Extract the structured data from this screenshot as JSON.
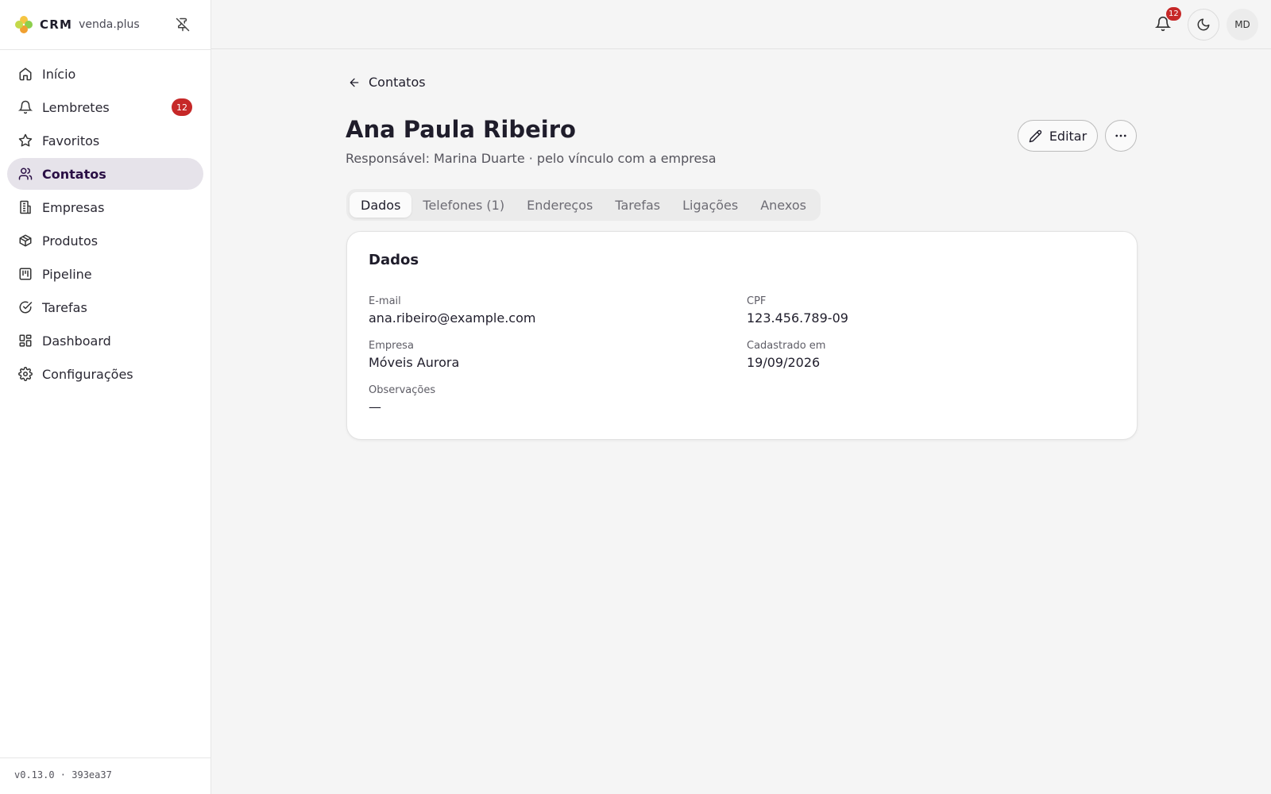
{
  "brand": {
    "name": "CRM",
    "subtitle": "venda.plus"
  },
  "sidebar": {
    "items": [
      {
        "label": "Início",
        "icon": "home-icon"
      },
      {
        "label": "Lembretes",
        "icon": "bell-icon",
        "badge": "12"
      },
      {
        "label": "Favoritos",
        "icon": "star-icon"
      },
      {
        "label": "Contatos",
        "icon": "users-icon",
        "active": true
      },
      {
        "label": "Empresas",
        "icon": "building-icon"
      },
      {
        "label": "Produtos",
        "icon": "package-icon"
      },
      {
        "label": "Pipeline",
        "icon": "kanban-icon"
      },
      {
        "label": "Tarefas",
        "icon": "check-circle-icon"
      },
      {
        "label": "Dashboard",
        "icon": "dashboard-icon"
      },
      {
        "label": "Configurações",
        "icon": "gear-icon"
      }
    ],
    "version": "v0.13.0 · 393ea37"
  },
  "topbar": {
    "notification_count": "12",
    "avatar_initials": "MD"
  },
  "page": {
    "back_label": "Contatos",
    "title": "Ana Paula Ribeiro",
    "subtitle": "Responsável: Marina Duarte · pelo vínculo com a empresa",
    "edit_label": "Editar"
  },
  "tabs": [
    {
      "label": "Dados",
      "active": true
    },
    {
      "label": "Telefones (1)"
    },
    {
      "label": "Endereços"
    },
    {
      "label": "Tarefas"
    },
    {
      "label": "Ligações"
    },
    {
      "label": "Anexos"
    }
  ],
  "card": {
    "title": "Dados",
    "fields": {
      "email": {
        "label": "E-mail",
        "value": "ana.ribeiro@example.com"
      },
      "cpf": {
        "label": "CPF",
        "value": "123.456.789-09"
      },
      "empresa": {
        "label": "Empresa",
        "value": "Móveis Aurora"
      },
      "cadastrado": {
        "label": "Cadastrado em",
        "value": "19/09/2026"
      },
      "observacoes": {
        "label": "Observações",
        "value": "—"
      }
    }
  },
  "colors": {
    "accent": "#2a0f45",
    "badge": "#c62828",
    "active_nav_bg": "#e6e3ea"
  }
}
